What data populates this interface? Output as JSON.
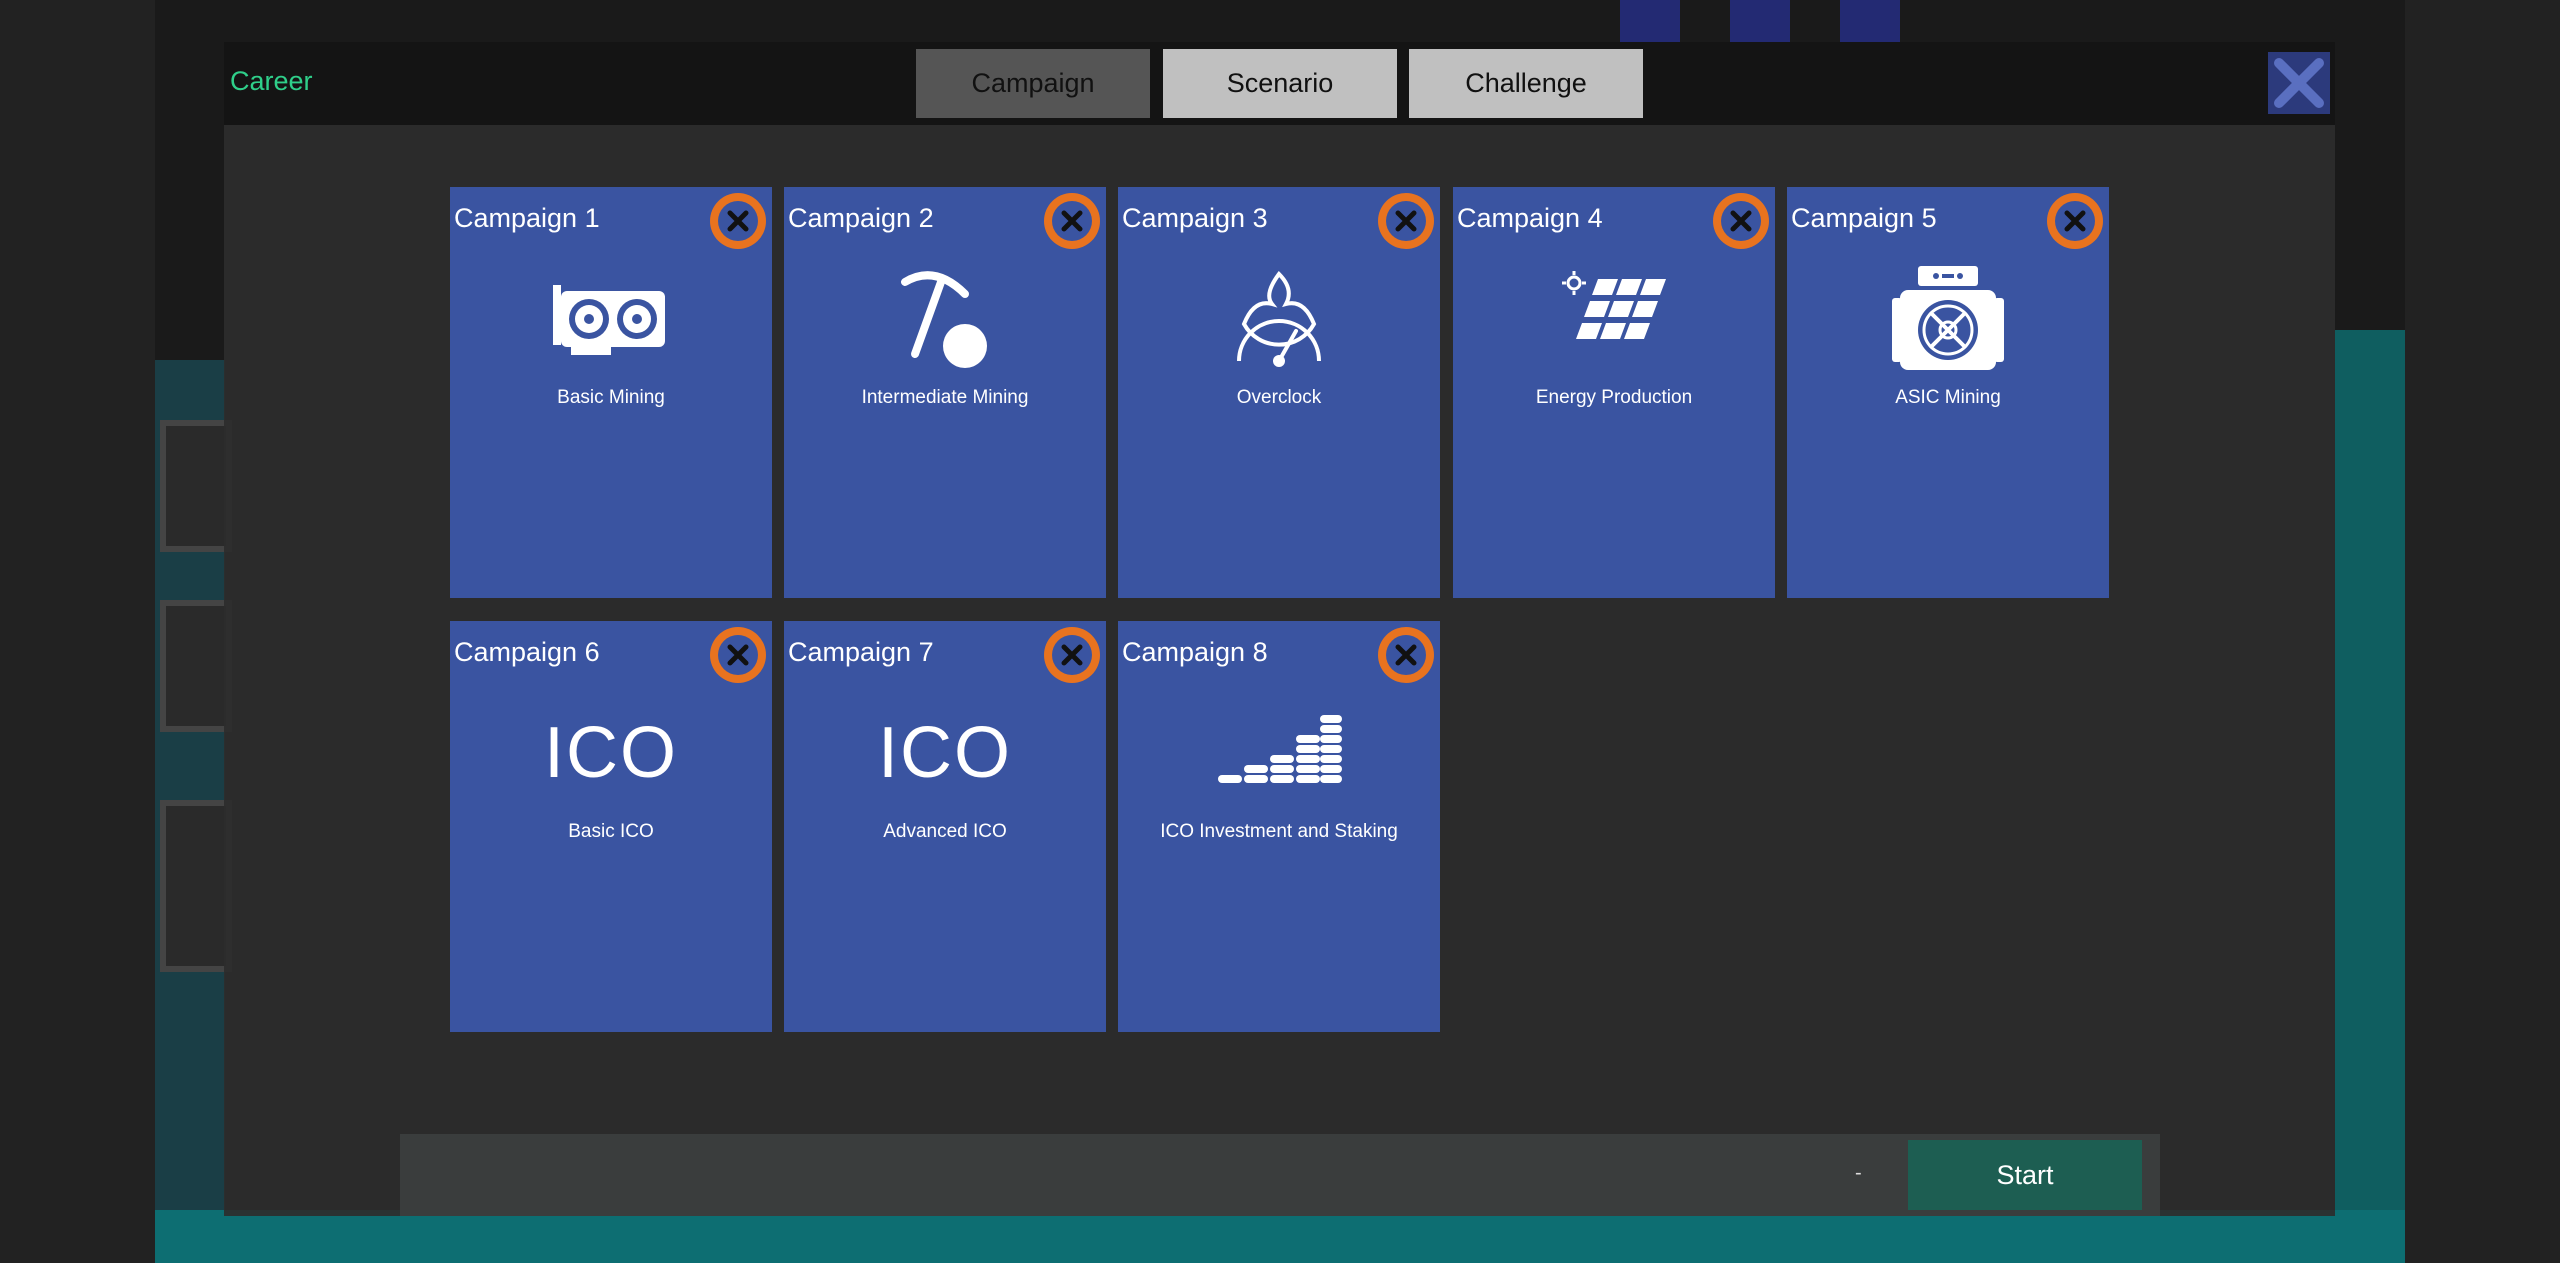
{
  "header": {
    "title": "Career",
    "tabs": [
      {
        "label": "Campaign",
        "active": true
      },
      {
        "label": "Scenario",
        "active": false
      },
      {
        "label": "Challenge",
        "active": false
      }
    ],
    "close_icon": "close-icon"
  },
  "campaigns": [
    {
      "title": "Campaign 1",
      "label": "Basic Mining",
      "icon": "gpu-card-icon"
    },
    {
      "title": "Campaign 2",
      "label": "Intermediate Mining",
      "icon": "pickaxe-coin-icon"
    },
    {
      "title": "Campaign 3",
      "label": "Overclock",
      "icon": "speedometer-flame-icon"
    },
    {
      "title": "Campaign 4",
      "label": "Energy Production",
      "icon": "solar-panel-icon"
    },
    {
      "title": "Campaign 5",
      "label": "ASIC Mining",
      "icon": "asic-miner-icon"
    },
    {
      "title": "Campaign 6",
      "label": "Basic ICO",
      "icon_text": "ICO"
    },
    {
      "title": "Campaign 7",
      "label": "Advanced ICO",
      "icon_text": "ICO"
    },
    {
      "title": "Campaign 8",
      "label": "ICO Investment and Staking",
      "icon": "coin-stacks-icon"
    }
  ],
  "footer": {
    "selection": "-",
    "start_label": "Start"
  },
  "colors": {
    "card": "#3a54a1",
    "badge": "#e8731f",
    "career": "#2fcf8a",
    "start": "#1d5e52"
  }
}
